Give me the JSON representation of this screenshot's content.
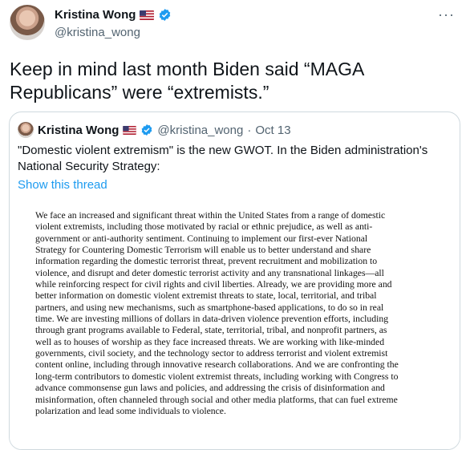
{
  "author": {
    "name": "Kristina Wong",
    "handle": "@kristina_wong",
    "flag_icon": "us-flag-icon",
    "verified_icon": "verified-badge-icon"
  },
  "more_icon": "ellipsis-icon",
  "more_label": "···",
  "tweet": {
    "text": "Keep in mind last month Biden said “MAGA Republicans” were “extremists.”"
  },
  "quoted": {
    "name": "Kristina Wong",
    "handle": "@kristina_wong",
    "separator": "·",
    "date": "Oct 13",
    "text": "\"Domestic violent extremism\" is the new GWOT. In the Biden administration's National Security Strategy:",
    "show_thread": "Show this thread",
    "document_text": "We face an increased and significant threat within the United States from a range of domestic\nviolent extremists, including those motivated by racial or ethnic prejudice, as well as anti-\ngovernment or anti-authority sentiment. Continuing to implement our first-ever National\nStrategy for Countering Domestic Terrorism will enable us to better understand and share\ninformation regarding the domestic terrorist threat, prevent recruitment and mobilization to\nviolence, and disrupt and deter domestic terrorist activity and any transnational linkages—all\nwhile reinforcing respect for civil rights and civil liberties. Already, we are providing more and\nbetter information on domestic violent extremist threats to state, local, territorial, and tribal\npartners, and using new mechanisms, such as smartphone-based applications, to do so in real\ntime. We are investing millions of dollars in data-driven violence prevention efforts, including\nthrough grant programs available to Federal, state, territorial, tribal, and nonprofit partners, as\nwell as to houses of worship as they face increased threats. We are working with like-minded\ngovernments, civil society, and the technology sector to address terrorist and violent extremist\ncontent online, including through innovative research collaborations. And we are confronting the\nlong-term contributors to domestic violent extremist threats, including working with Congress to\nadvance commonsense gun laws and policies, and addressing the crisis of disinformation and\nmisinformation, often channeled through social and other media platforms, that can fuel extreme\npolarization and lead some individuals to violence."
  },
  "colors": {
    "link": "#1d9bf0",
    "secondary_text": "#536471",
    "border": "#cfd9de",
    "verified": "#1d9bf0"
  }
}
